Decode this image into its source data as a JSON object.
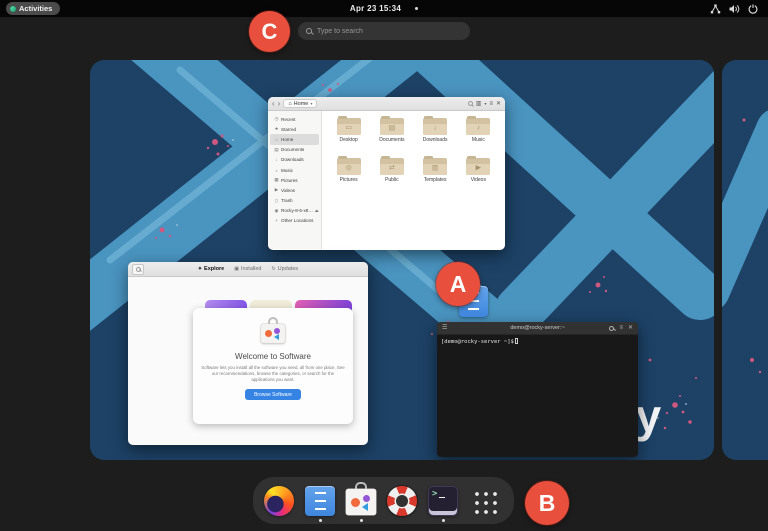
{
  "top_bar": {
    "activities_label": "Activities",
    "clock": "Apr 23 15:34",
    "notification_dot": true,
    "status_icons": [
      "network-wired-icon",
      "volume-icon",
      "power-icon"
    ]
  },
  "search": {
    "placeholder": "Type to search"
  },
  "markers": {
    "a": "A",
    "b": "B",
    "c": "C"
  },
  "wallpaper": {
    "brand_text": "ky"
  },
  "files_window": {
    "breadcrumb": "Home",
    "header_icons": [
      "back",
      "forward",
      "search",
      "view-grid",
      "menu",
      "close"
    ],
    "sidebar": [
      "Recent",
      "Starred",
      "Home",
      "Documents",
      "Downloads",
      "Music",
      "Pictures",
      "Videos",
      "Trash",
      "Rocky-8-5-x8…",
      "Other Locations"
    ],
    "selected_sidebar_index": 2,
    "folders": [
      "Desktop",
      "Documents",
      "Downloads",
      "Music",
      "Pictures",
      "Public",
      "Templates",
      "Videos"
    ]
  },
  "software_window": {
    "tabs": [
      "Explore",
      "Installed",
      "Updates"
    ],
    "active_tab_index": 0,
    "welcome_title": "Welcome to Software",
    "welcome_body": "Software lets you install all the software you need, all from one place. See our recommendations, browse the categories, or search for the applications you want.",
    "browse_button_label": "Browse Software"
  },
  "terminal_window": {
    "title": "demo@rocky-server:~",
    "prompt": "[demo@rocky-server ~]$"
  },
  "dock": {
    "items": [
      {
        "id": "firefox",
        "running": false
      },
      {
        "id": "files",
        "running": true
      },
      {
        "id": "software",
        "running": true
      },
      {
        "id": "help",
        "running": false
      },
      {
        "id": "terminal",
        "running": true
      },
      {
        "id": "app-grid",
        "running": false
      }
    ]
  },
  "colors": {
    "accent": "#3584e4",
    "marker_red": "#e94f3d",
    "wallpaper_blue": "#1d4266",
    "wallpaper_stroke": "#4e9bc7",
    "splatter_pink": "#cf5880"
  }
}
